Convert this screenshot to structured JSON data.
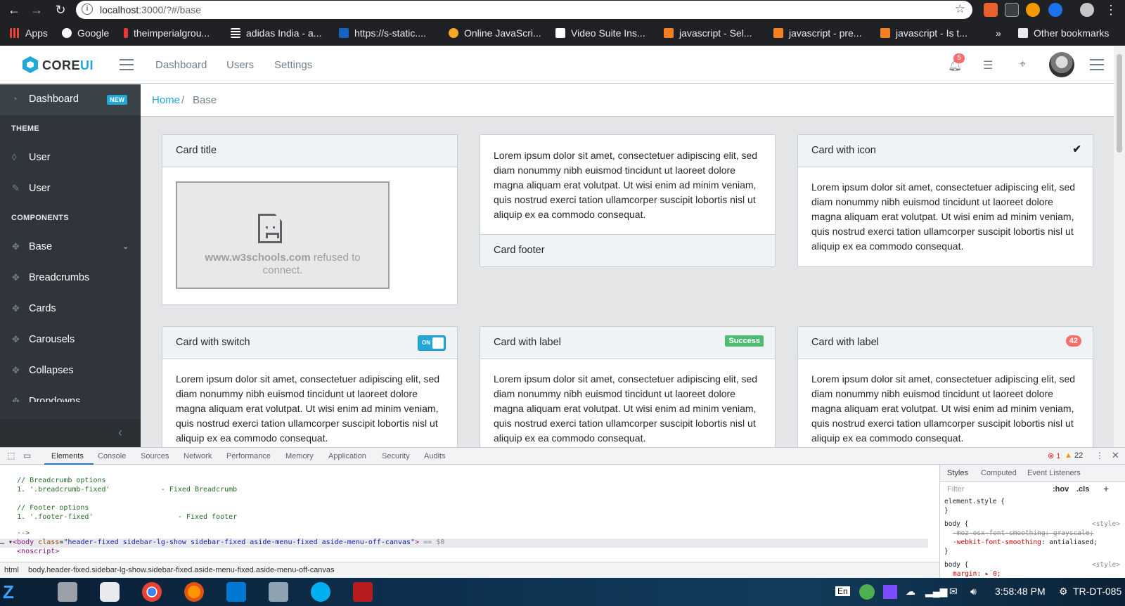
{
  "browser": {
    "url_host": "localhost",
    "url_rest": ":3000/?#/base",
    "bookmarks": [
      {
        "label": "Apps",
        "color": "#ea4335"
      },
      {
        "label": "Google",
        "color": "#ffffff"
      },
      {
        "label": "theimperialgrou...",
        "color": "#e53935"
      },
      {
        "label": "adidas India - a...",
        "color": "#ffffff"
      },
      {
        "label": "https://s-static....",
        "color": "#1565c0"
      },
      {
        "label": "Online JavaScri...",
        "color": "#f9a825"
      },
      {
        "label": "Video Suite Ins...",
        "color": "#ffffff"
      },
      {
        "label": "javascript - Sel...",
        "color": "#f48024"
      },
      {
        "label": "javascript - pre...",
        "color": "#f48024"
      },
      {
        "label": "javascript - Is t...",
        "color": "#f48024"
      }
    ],
    "more_bookmarks": "»",
    "other_bookmarks": "Other bookmarks"
  },
  "header": {
    "logo_core": "CORE",
    "logo_ui": "UI",
    "nav": [
      "Dashboard",
      "Users",
      "Settings"
    ],
    "bell_count": "5"
  },
  "sidebar": {
    "dashboard": {
      "label": "Dashboard",
      "badge": "NEW"
    },
    "theme_title": "THEME",
    "theme_items": [
      "User",
      "User"
    ],
    "components_title": "COMPONENTS",
    "components_items": [
      "Base",
      "Breadcrumbs",
      "Cards",
      "Carousels",
      "Collapses",
      "Dropdowns"
    ]
  },
  "breadcrumb": {
    "home": "Home",
    "separator": "/",
    "current": "Base"
  },
  "cards": {
    "lorem": "Lorem ipsum dolor sit amet, consectetuer adipiscing elit, sed diam nonummy nibh euismod tincidunt ut laoreet dolore magna aliquam erat volutpat. Ut wisi enim ad minim veniam, quis nostrud exerci tation ullamcorper suscipit lobortis nisl ut aliquip ex ea commodo consequat.",
    "card1_title": "Card title",
    "iframe_domain": "www.w3schools.com",
    "iframe_msg": "refused to connect.",
    "card2_footer": "Card footer",
    "card3_title": "Card with icon",
    "card4_title": "Card with switch",
    "switch_label": "ON",
    "card5_title": "Card with label",
    "card5_badge": "Success",
    "card6_title": "Card with label",
    "card6_badge": "42"
  },
  "devtools": {
    "tabs": [
      "Elements",
      "Console",
      "Sources",
      "Network",
      "Performance",
      "Memory",
      "Application",
      "Security",
      "Audits"
    ],
    "errors": "1",
    "warnings": "22",
    "code": {
      "l1": "// Breadcrumb options",
      "l2": "1. '.breadcrumb-fixed'",
      "l2b": "- Fixed Breadcrumb",
      "l3": "// Footer options",
      "l4": "1. '.footer-fixed'",
      "l4b": "- Fixed footer",
      "l5": "-->",
      "body_tag": "body",
      "body_attr": "class",
      "body_val": "\"header-fixed sidebar-lg-show sidebar-fixed aside-menu-fixed aside-menu-off-canvas\"",
      "body_suffix": "== $0",
      "noscript": "<noscript>"
    },
    "styles_tabs": [
      "Styles",
      "Computed",
      "Event Listeners"
    ],
    "filter_placeholder": "Filter",
    "hov": ":hov",
    "cls": ".cls",
    "rules": {
      "r1": "element.style {",
      "r1end": "}",
      "r2sel": "body {",
      "r2src": "<style>",
      "r2p1": "-moz-osx-font-smoothing: grayscale;",
      "r2p2name": "-webkit-font-smoothing",
      "r2p2val": "antialiased;",
      "r3sel": "body {",
      "r3src": "<style>",
      "r3p1": "margin: ▸ 0;"
    },
    "crumb_html": "html",
    "crumb_body": "body.header-fixed.sidebar-lg-show.sidebar-fixed.aside-menu-fixed.aside-menu-off-canvas"
  },
  "taskbar": {
    "lang": "En",
    "time": "3:58:48 PM",
    "machine": "TR-DT-085"
  }
}
